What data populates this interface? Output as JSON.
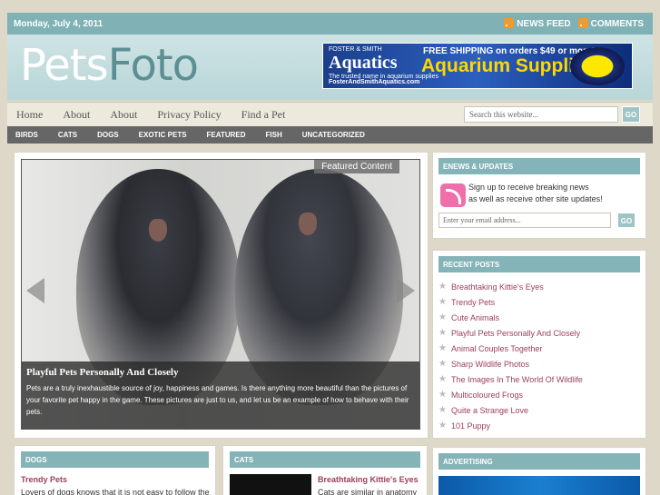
{
  "topbar": {
    "date": "Monday, July 4, 2011",
    "news_feed": "NEWS FEED",
    "comments": "COMMENTS"
  },
  "logo": {
    "part1": "Pets",
    "part2": "Foto"
  },
  "header_ad": {
    "brand": "Aquatics",
    "brand_top": "FOSTER & SMITH",
    "tagline": "The trusted name in aquarium supplies",
    "shipping": "FREE SHIPPING on orders $49 or more!",
    "headline": "Aquarium Supplies",
    "url": "FosterAndSmithAquatics.com"
  },
  "nav": {
    "items": [
      "Home",
      "About",
      "About",
      "Privacy Policy",
      "Find a Pet"
    ],
    "search_placeholder": "Search this website...",
    "go": "GO"
  },
  "categories": [
    "BIRDS",
    "CATS",
    "DOGS",
    "EXOTIC PETS",
    "FEATURED",
    "FISH",
    "UNCATEGORIZED"
  ],
  "featured": {
    "tag": "Featured Content",
    "title": "Playful Pets Personally And Closely",
    "text": "Pets are a truly inexhaustible source of joy, happiness and games. Is there anything more beautiful than the pictures of your favorite pet happy in the game. These pictures are just to us, and let us be an example of how to behave with their pets."
  },
  "enews": {
    "title": "ENEWS & UPDATES",
    "line1": "Sign up to receive breaking news",
    "line2": "as well as receive other site updates!",
    "email_placeholder": "Enter your email address...",
    "go": "GO"
  },
  "recent": {
    "title": "RECENT POSTS",
    "items": [
      "Breathtaking Kittie's Eyes",
      "Trendy Pets",
      "Cute Animals",
      "Playful Pets Personally And Closely",
      "Animal Couples Together",
      "Sharp Wildlife Photos",
      "The Images In The World Of Wildlife",
      "Multicoloured Frogs",
      "Quite a Strange Love",
      "101 Puppy"
    ]
  },
  "dogs": {
    "title": "DOGS",
    "post_title": "Trendy Pets",
    "excerpt": "Lovers of dogs knows that it is not easy to follow the"
  },
  "cats": {
    "title": "CATS",
    "post_title": "Breathtaking Kittie's Eyes",
    "excerpt": "Cats are similar in anatomy"
  },
  "advertising": {
    "title": "ADVERTISING"
  }
}
